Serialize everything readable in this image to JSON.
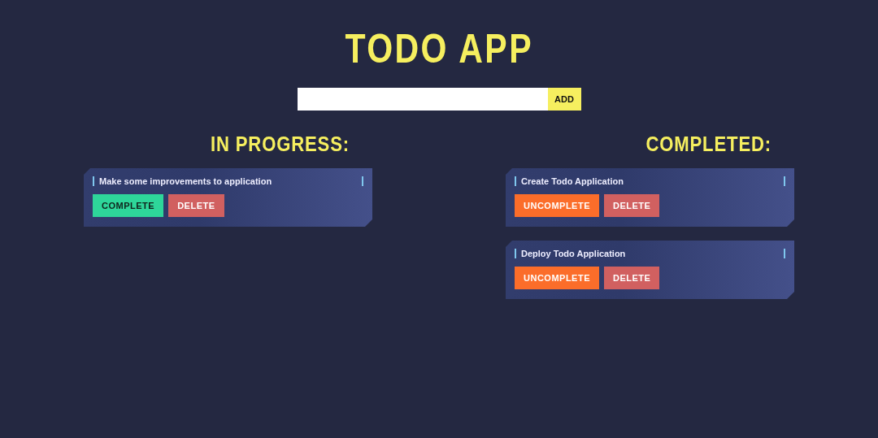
{
  "title": "TODO APP",
  "add_form": {
    "button": "ADD"
  },
  "sections": [
    {
      "heading": "IN PROGRESS:",
      "tasks": [
        {
          "text": "Make some improvements to application",
          "buttons": [
            {
              "label": "COMPLETE",
              "kind": "complete"
            },
            {
              "label": "DELETE",
              "kind": "delete"
            }
          ]
        }
      ]
    },
    {
      "heading": "COMPLETED:",
      "tasks": [
        {
          "text": "Create Todo Application",
          "buttons": [
            {
              "label": "UNCOMPLETE",
              "kind": "uncomplete"
            },
            {
              "label": "DELETE",
              "kind": "delete"
            }
          ]
        },
        {
          "text": "Deploy Todo Application",
          "buttons": [
            {
              "label": "UNCOMPLETE",
              "kind": "uncomplete"
            },
            {
              "label": "DELETE",
              "kind": "delete"
            }
          ]
        }
      ]
    }
  ]
}
